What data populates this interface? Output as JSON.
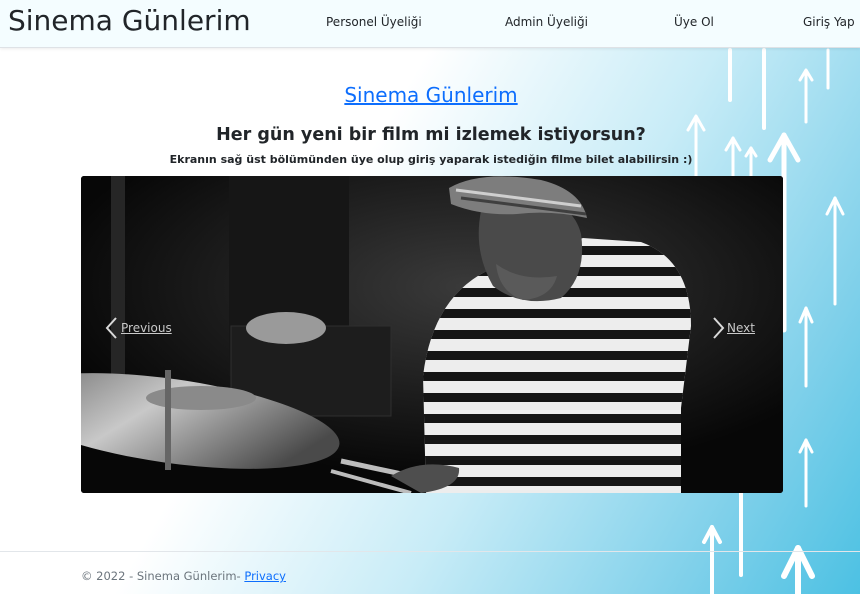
{
  "nav": {
    "brand": "Sinema Günlerim",
    "links": [
      "Personel Üyeliği",
      "Admin Üyeliği",
      "Üye Ol",
      "Giriş Yap"
    ]
  },
  "hero": {
    "title": "Sinema Günlerim",
    "headline": "Her gün yeni bir film mi izlemek istiyorsun?",
    "subline": "Ekranın sağ üst bölümünden üye olup giriş yaparak istediğin filme bilet alabilirsin :)"
  },
  "carousel": {
    "prev_label": "Previous",
    "next_label": "Next",
    "prev_icon": "chevron-left-icon",
    "next_icon": "chevron-right-icon"
  },
  "footer": {
    "copyright": "© 2022 - Sinema Günlerim- ",
    "privacy_label": "Privacy"
  },
  "colors": {
    "link": "#0d6efd",
    "navbar_bg": "#f4fdff",
    "gradient_end": "#4cc1e3"
  }
}
